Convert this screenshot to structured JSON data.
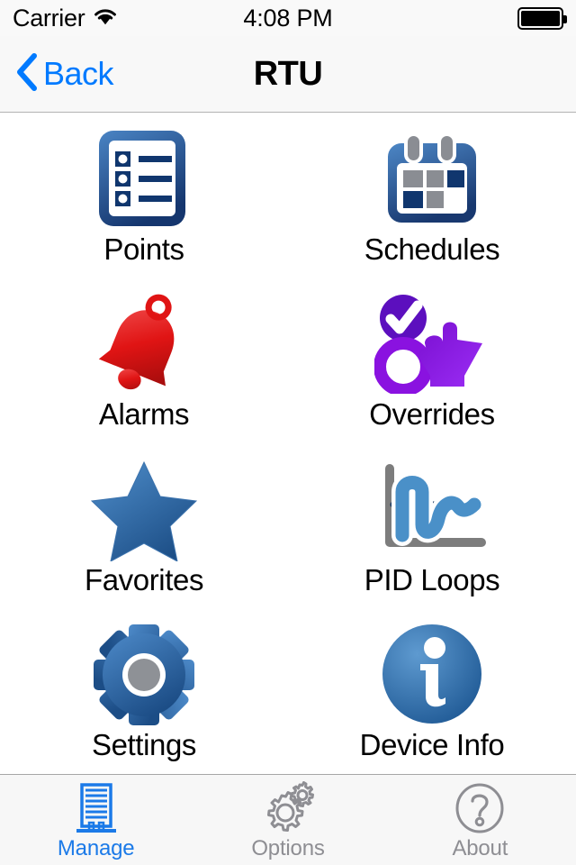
{
  "status_bar": {
    "carrier": "Carrier",
    "wifi_icon": "wifi-icon",
    "time": "4:08 PM",
    "battery_icon": "battery-full-icon"
  },
  "nav_bar": {
    "back_label": "Back",
    "back_icon": "chevron-left-icon",
    "title": "RTU"
  },
  "grid": {
    "items": [
      {
        "label": "Points",
        "icon": "document-list-icon"
      },
      {
        "label": "Schedules",
        "icon": "calendar-icon"
      },
      {
        "label": "Alarms",
        "icon": "bell-icon"
      },
      {
        "label": "Overrides",
        "icon": "hand-pointer-checkmark-icon"
      },
      {
        "label": "Favorites",
        "icon": "star-icon"
      },
      {
        "label": "PID Loops",
        "icon": "graph-curve-icon"
      },
      {
        "label": "Settings",
        "icon": "gear-icon"
      },
      {
        "label": "Device Info",
        "icon": "info-circle-icon"
      }
    ]
  },
  "tab_bar": {
    "items": [
      {
        "label": "Manage",
        "icon": "building-icon",
        "active": true
      },
      {
        "label": "Options",
        "icon": "gears-icon",
        "active": false
      },
      {
        "label": "About",
        "icon": "question-circle-icon",
        "active": false
      }
    ]
  },
  "colors": {
    "accent_blue": "#007aff",
    "tab_active": "#1b7ae8",
    "tab_inactive": "#8e8e93",
    "alarm_red": "#e02020",
    "override_purple": "#8a12e0",
    "nav_background": "#f8f8f8"
  }
}
